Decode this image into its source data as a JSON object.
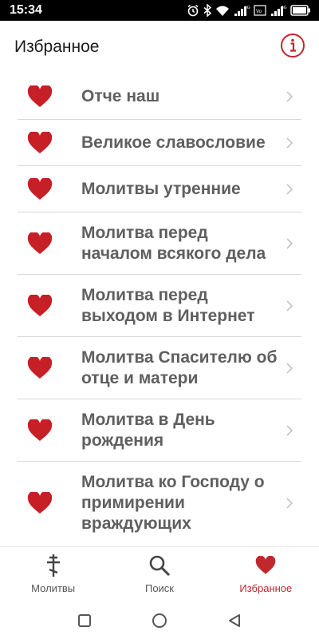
{
  "status_bar": {
    "time": "15:34",
    "icons": [
      "alarm-icon",
      "bluetooth-icon",
      "wifi-icon",
      "signal-4g-icon",
      "volte-icon",
      "signal-4g-icon",
      "battery-icon"
    ]
  },
  "header": {
    "title": "Избранное",
    "info_icon": "info-icon"
  },
  "favorites": [
    {
      "label": "Отче наш"
    },
    {
      "label": "Великое славословие"
    },
    {
      "label": "Молитвы утренние"
    },
    {
      "label": "Молитва перед началом всякого дела"
    },
    {
      "label": "Молитва перед выходом в Интернет"
    },
    {
      "label": "Молитва Спасителю об отце и матери"
    },
    {
      "label": "Молитва в День рождения"
    },
    {
      "label": "Молитва ко Господу о примирении враждующих"
    }
  ],
  "bottom_nav": {
    "items": [
      {
        "label": "Молитвы",
        "icon": "orthodox-cross-icon",
        "active": false
      },
      {
        "label": "Поиск",
        "icon": "search-icon",
        "active": false
      },
      {
        "label": "Избранное",
        "icon": "heart-icon",
        "active": true
      }
    ]
  },
  "colors": {
    "accent": "#c0282d",
    "heart": "#c61f26",
    "text": "#5f5f5f",
    "divider": "#d8d8d8"
  }
}
